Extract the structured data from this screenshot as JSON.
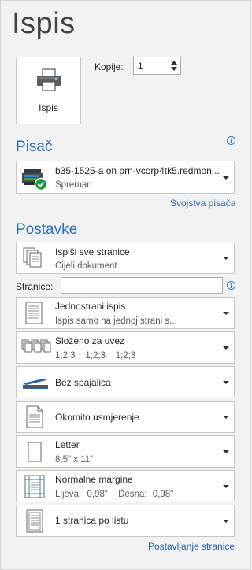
{
  "page": {
    "title": "Ispis"
  },
  "print_button": {
    "label": "Ispis",
    "icon": "printer-icon"
  },
  "copies": {
    "label": "Kopije:",
    "value": "1"
  },
  "printer_section": {
    "title": "Pisač",
    "printer": {
      "name": "b35-1525-a on prn-vcorp4tk5.redmon...",
      "status": "Spreman",
      "icon": "printer-ready-icon"
    },
    "properties_link": "Svojstva pisača"
  },
  "settings_section": {
    "title": "Postavke",
    "pages_label": "Stranice:",
    "pages_value": "",
    "options": [
      {
        "title": "Ispiši sve stranice",
        "subtitle": "Cijeli dokument",
        "icon": "pages-icon"
      },
      {
        "title": "Jednostrani ispis",
        "subtitle": "Ispis samo na jednoj strani s...",
        "icon": "one-sided-icon"
      },
      {
        "title": "Složeno za uvez",
        "subtitle": "1;2;3    1;2;3    1;2;3",
        "icon": "collated-icon"
      },
      {
        "title": "Bez spajalica",
        "subtitle": "",
        "icon": "stapler-icon"
      },
      {
        "title": "Okomito usmjerenje",
        "subtitle": "",
        "icon": "portrait-icon"
      },
      {
        "title": "Letter",
        "subtitle": "8,5\" x 11\"",
        "icon": "paper-size-icon"
      },
      {
        "title": "Normalne margine",
        "subtitle_left_label": "Lijeva:",
        "subtitle_left_value": "0,98\"",
        "subtitle_right_label": "Desna:",
        "subtitle_right_value": "0,98\"",
        "icon": "margins-icon"
      },
      {
        "title": "1 stranica po listu",
        "subtitle": "",
        "icon": "pages-per-sheet-icon"
      }
    ],
    "page_setup_link": "Postavljanje stranice"
  },
  "colors": {
    "accent": "#2e6db3",
    "link": "#2a63a8",
    "background": "#f2f2f2"
  }
}
